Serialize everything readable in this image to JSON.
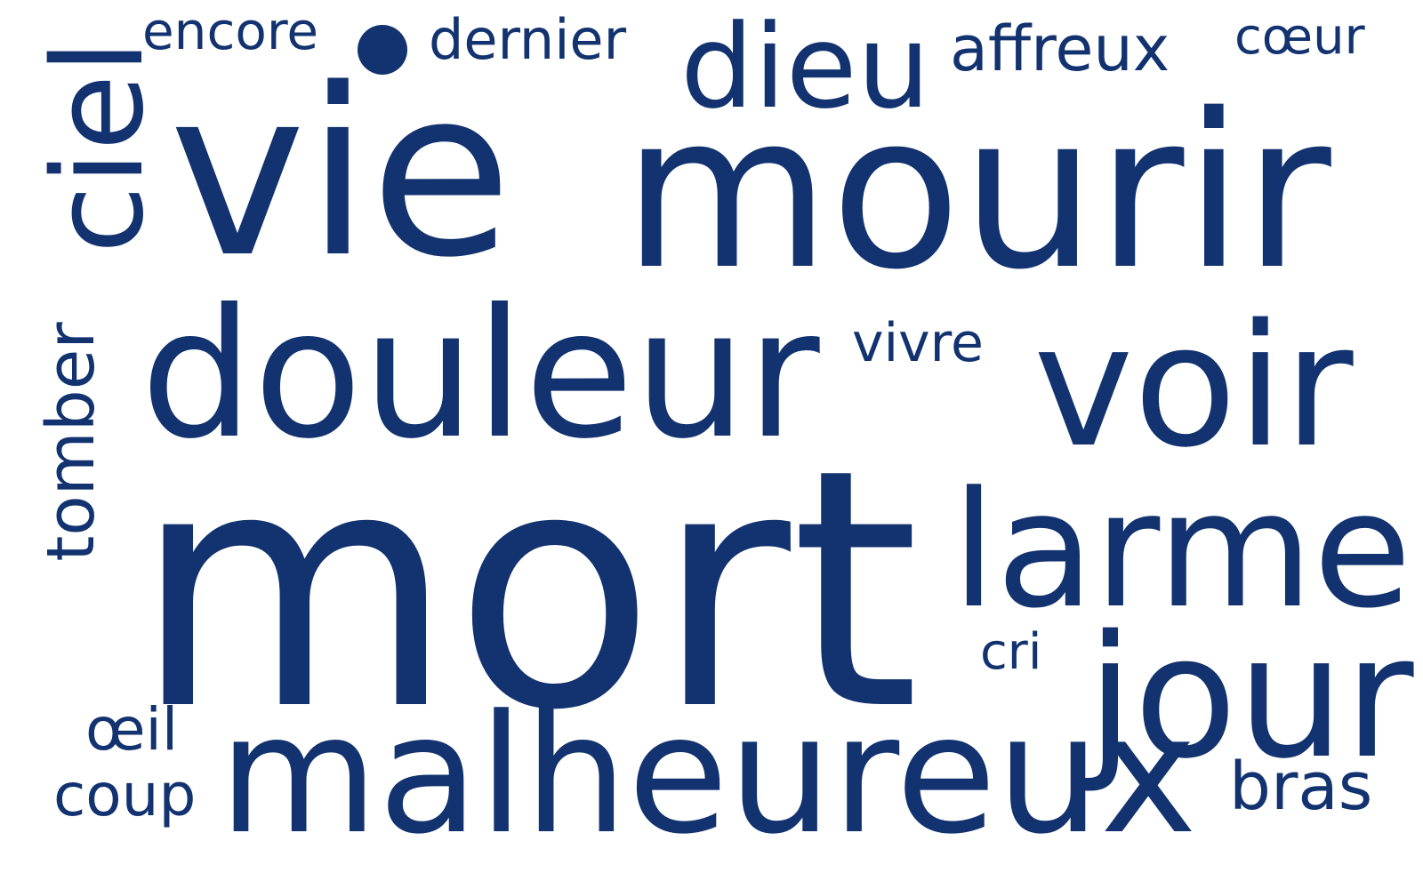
{
  "colors": {
    "text": "#12336f",
    "background": "#ffffff"
  },
  "words": {
    "mort": "mort",
    "vie": "vie",
    "mourir": "mourir",
    "douleur": "douleur",
    "malheureux": "malheureux",
    "voir": "voir",
    "larme": "larme",
    "jour": "jour",
    "dieu": "dieu",
    "ciel": "ciel",
    "tomber": "tomber",
    "encore": "encore",
    "dernier": "dernier",
    "affreux": "affreux",
    "coeur": "cœur",
    "vivre": "vivre",
    "cri": "cri",
    "oeil": "œil",
    "coup": "coup",
    "bras": "bras"
  }
}
